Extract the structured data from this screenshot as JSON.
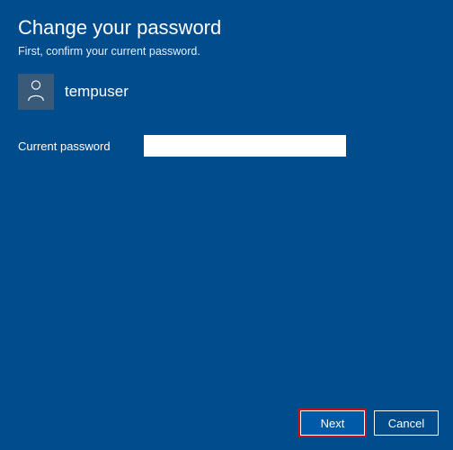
{
  "header": {
    "title": "Change your password",
    "subtitle": "First, confirm your current password."
  },
  "user": {
    "name": "tempuser"
  },
  "form": {
    "current_password_label": "Current password",
    "current_password_value": ""
  },
  "buttons": {
    "next": "Next",
    "cancel": "Cancel"
  }
}
